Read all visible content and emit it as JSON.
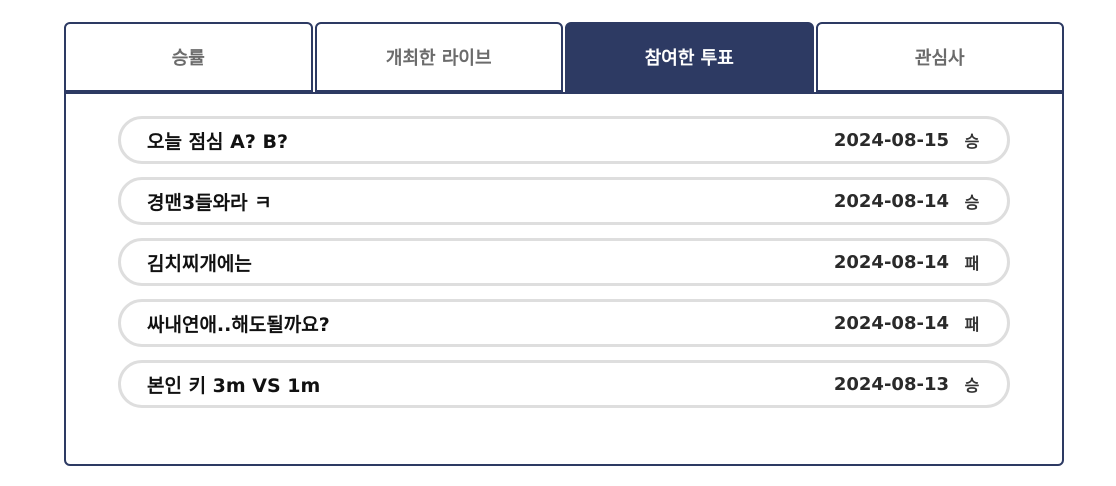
{
  "tabs": [
    {
      "label": "승률",
      "active": false
    },
    {
      "label": "개최한 라이브",
      "active": false
    },
    {
      "label": "참여한 투표",
      "active": true
    },
    {
      "label": "관심사",
      "active": false
    }
  ],
  "votes": [
    {
      "title": "오늘 점심 A? B?",
      "date": "2024-08-15",
      "result": "승"
    },
    {
      "title": "경맨3들와라 ㅋ",
      "date": "2024-08-14",
      "result": "승"
    },
    {
      "title": "김치찌개에는",
      "date": "2024-08-14",
      "result": "패"
    },
    {
      "title": "싸내연애..해도될까요?",
      "date": "2024-08-14",
      "result": "패"
    },
    {
      "title": "본인 키 3m VS 1m",
      "date": "2024-08-13",
      "result": "승"
    }
  ],
  "colors": {
    "accent": "#2d3a63",
    "row_border": "#dedede"
  }
}
